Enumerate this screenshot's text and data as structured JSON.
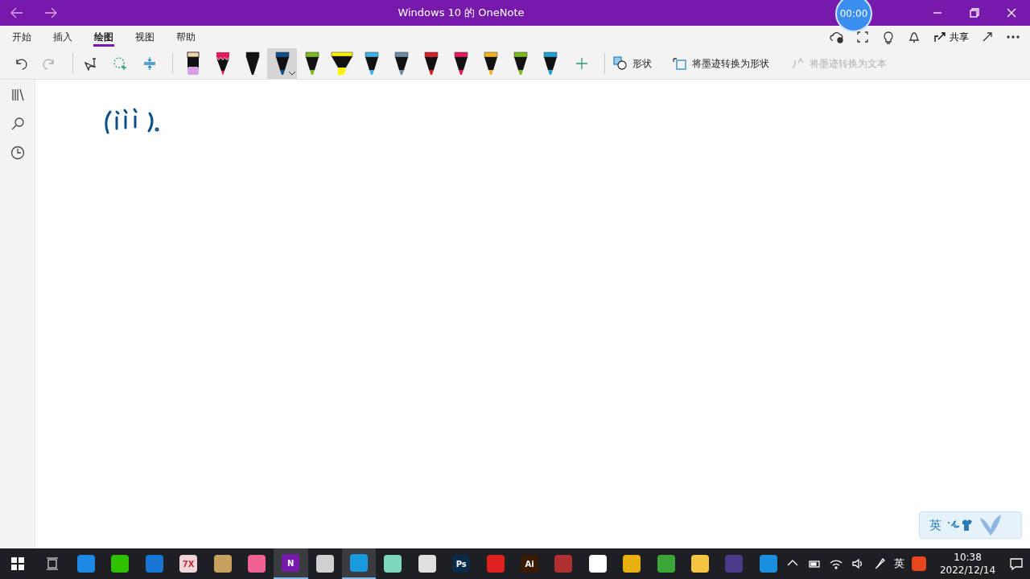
{
  "window": {
    "title": "Windows 10 的 OneNote"
  },
  "recorder": {
    "time": "00:00"
  },
  "tabs": [
    {
      "label": "开始",
      "selected": false
    },
    {
      "label": "插入",
      "selected": false
    },
    {
      "label": "绘图",
      "selected": true
    },
    {
      "label": "视图",
      "selected": false
    },
    {
      "label": "帮助",
      "selected": false
    }
  ],
  "share": {
    "label": "共享"
  },
  "pens": [
    {
      "kind": "eraser",
      "color": "#d9a3e3",
      "selected": false
    },
    {
      "kind": "pencil",
      "color": "#e3195b",
      "selected": false
    },
    {
      "kind": "pen",
      "color": "#111111",
      "selected": false
    },
    {
      "kind": "pen",
      "color": "#0b4f8c",
      "selected": true
    },
    {
      "kind": "pen",
      "color": "#7dbb1a",
      "selected": false
    },
    {
      "kind": "highlighter",
      "color": "#fff200",
      "selected": false
    },
    {
      "kind": "pen",
      "color": "#3ab3ea",
      "selected": false
    },
    {
      "kind": "pen",
      "color": "#6b8aa3",
      "selected": false
    },
    {
      "kind": "pen",
      "color": "#d6202c",
      "selected": false
    },
    {
      "kind": "pen",
      "color": "#e8195c",
      "selected": false
    },
    {
      "kind": "pen",
      "color": "#f2b323",
      "selected": false
    },
    {
      "kind": "pen",
      "color": "#7dbb1a",
      "selected": false
    },
    {
      "kind": "pen",
      "color": "#1ea3d9",
      "selected": false
    }
  ],
  "tools": [
    {
      "label": "形状",
      "disabled": false
    },
    {
      "label": "将墨迹转换为形状",
      "disabled": false
    },
    {
      "label": "将墨迹转换为文本",
      "disabled": true
    }
  ],
  "ime_bar": {
    "label": "英"
  },
  "taskbar": {
    "apps": [
      {
        "kind": "tile",
        "color": "#1e88e5",
        "running": false
      },
      {
        "kind": "tile",
        "color": "#2dc100",
        "running": false
      },
      {
        "kind": "tile",
        "color": "#1976d2",
        "running": false
      },
      {
        "kind": "tile",
        "label": "7X",
        "color": "#f2d5d8",
        "running": false
      },
      {
        "kind": "tile",
        "color": "#c8a060",
        "running": false
      },
      {
        "kind": "tile",
        "color": "#f06292",
        "running": false
      },
      {
        "kind": "tile",
        "label": "N",
        "color": "#7719aa",
        "running": true
      },
      {
        "kind": "tile",
        "color": "#d0d0d0",
        "running": false
      },
      {
        "kind": "tile",
        "color": "#1a9be0",
        "running": true
      },
      {
        "kind": "tile",
        "color": "#7fd6c0",
        "running": false
      },
      {
        "kind": "tile",
        "color": "#e0e0e0",
        "running": false
      },
      {
        "kind": "tile",
        "label": "Ps",
        "color": "#0b2a4a",
        "running": false
      },
      {
        "kind": "tile",
        "color": "#e02020",
        "running": false
      },
      {
        "kind": "tile",
        "label": "Ai",
        "color": "#3a1a00",
        "running": false
      },
      {
        "kind": "tile",
        "color": "#b03030",
        "running": false
      },
      {
        "kind": "tile",
        "color": "#ffffff",
        "running": false
      },
      {
        "kind": "tile",
        "color": "#e8b010",
        "running": false
      },
      {
        "kind": "tile",
        "color": "#3aa635",
        "running": false
      },
      {
        "kind": "tile",
        "color": "#f5c542",
        "running": false
      },
      {
        "kind": "tile",
        "color": "#4b3a8a",
        "running": false
      },
      {
        "kind": "tile",
        "color": "#1a8fe0",
        "running": false
      }
    ],
    "ime": "英",
    "time": "10:38",
    "date": "2022/12/14"
  }
}
